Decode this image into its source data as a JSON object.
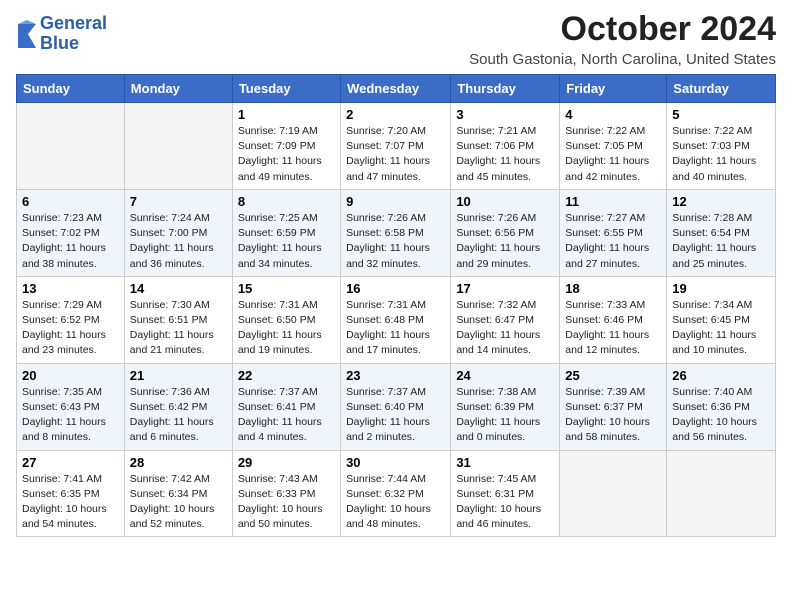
{
  "logo": {
    "line1": "General",
    "line2": "Blue"
  },
  "title": "October 2024",
  "subtitle": "South Gastonia, North Carolina, United States",
  "weekdays": [
    "Sunday",
    "Monday",
    "Tuesday",
    "Wednesday",
    "Thursday",
    "Friday",
    "Saturday"
  ],
  "weeks": [
    [
      {
        "day": "",
        "detail": ""
      },
      {
        "day": "",
        "detail": ""
      },
      {
        "day": "1",
        "detail": "Sunrise: 7:19 AM\nSunset: 7:09 PM\nDaylight: 11 hours and 49 minutes."
      },
      {
        "day": "2",
        "detail": "Sunrise: 7:20 AM\nSunset: 7:07 PM\nDaylight: 11 hours and 47 minutes."
      },
      {
        "day": "3",
        "detail": "Sunrise: 7:21 AM\nSunset: 7:06 PM\nDaylight: 11 hours and 45 minutes."
      },
      {
        "day": "4",
        "detail": "Sunrise: 7:22 AM\nSunset: 7:05 PM\nDaylight: 11 hours and 42 minutes."
      },
      {
        "day": "5",
        "detail": "Sunrise: 7:22 AM\nSunset: 7:03 PM\nDaylight: 11 hours and 40 minutes."
      }
    ],
    [
      {
        "day": "6",
        "detail": "Sunrise: 7:23 AM\nSunset: 7:02 PM\nDaylight: 11 hours and 38 minutes."
      },
      {
        "day": "7",
        "detail": "Sunrise: 7:24 AM\nSunset: 7:00 PM\nDaylight: 11 hours and 36 minutes."
      },
      {
        "day": "8",
        "detail": "Sunrise: 7:25 AM\nSunset: 6:59 PM\nDaylight: 11 hours and 34 minutes."
      },
      {
        "day": "9",
        "detail": "Sunrise: 7:26 AM\nSunset: 6:58 PM\nDaylight: 11 hours and 32 minutes."
      },
      {
        "day": "10",
        "detail": "Sunrise: 7:26 AM\nSunset: 6:56 PM\nDaylight: 11 hours and 29 minutes."
      },
      {
        "day": "11",
        "detail": "Sunrise: 7:27 AM\nSunset: 6:55 PM\nDaylight: 11 hours and 27 minutes."
      },
      {
        "day": "12",
        "detail": "Sunrise: 7:28 AM\nSunset: 6:54 PM\nDaylight: 11 hours and 25 minutes."
      }
    ],
    [
      {
        "day": "13",
        "detail": "Sunrise: 7:29 AM\nSunset: 6:52 PM\nDaylight: 11 hours and 23 minutes."
      },
      {
        "day": "14",
        "detail": "Sunrise: 7:30 AM\nSunset: 6:51 PM\nDaylight: 11 hours and 21 minutes."
      },
      {
        "day": "15",
        "detail": "Sunrise: 7:31 AM\nSunset: 6:50 PM\nDaylight: 11 hours and 19 minutes."
      },
      {
        "day": "16",
        "detail": "Sunrise: 7:31 AM\nSunset: 6:48 PM\nDaylight: 11 hours and 17 minutes."
      },
      {
        "day": "17",
        "detail": "Sunrise: 7:32 AM\nSunset: 6:47 PM\nDaylight: 11 hours and 14 minutes."
      },
      {
        "day": "18",
        "detail": "Sunrise: 7:33 AM\nSunset: 6:46 PM\nDaylight: 11 hours and 12 minutes."
      },
      {
        "day": "19",
        "detail": "Sunrise: 7:34 AM\nSunset: 6:45 PM\nDaylight: 11 hours and 10 minutes."
      }
    ],
    [
      {
        "day": "20",
        "detail": "Sunrise: 7:35 AM\nSunset: 6:43 PM\nDaylight: 11 hours and 8 minutes."
      },
      {
        "day": "21",
        "detail": "Sunrise: 7:36 AM\nSunset: 6:42 PM\nDaylight: 11 hours and 6 minutes."
      },
      {
        "day": "22",
        "detail": "Sunrise: 7:37 AM\nSunset: 6:41 PM\nDaylight: 11 hours and 4 minutes."
      },
      {
        "day": "23",
        "detail": "Sunrise: 7:37 AM\nSunset: 6:40 PM\nDaylight: 11 hours and 2 minutes."
      },
      {
        "day": "24",
        "detail": "Sunrise: 7:38 AM\nSunset: 6:39 PM\nDaylight: 11 hours and 0 minutes."
      },
      {
        "day": "25",
        "detail": "Sunrise: 7:39 AM\nSunset: 6:37 PM\nDaylight: 10 hours and 58 minutes."
      },
      {
        "day": "26",
        "detail": "Sunrise: 7:40 AM\nSunset: 6:36 PM\nDaylight: 10 hours and 56 minutes."
      }
    ],
    [
      {
        "day": "27",
        "detail": "Sunrise: 7:41 AM\nSunset: 6:35 PM\nDaylight: 10 hours and 54 minutes."
      },
      {
        "day": "28",
        "detail": "Sunrise: 7:42 AM\nSunset: 6:34 PM\nDaylight: 10 hours and 52 minutes."
      },
      {
        "day": "29",
        "detail": "Sunrise: 7:43 AM\nSunset: 6:33 PM\nDaylight: 10 hours and 50 minutes."
      },
      {
        "day": "30",
        "detail": "Sunrise: 7:44 AM\nSunset: 6:32 PM\nDaylight: 10 hours and 48 minutes."
      },
      {
        "day": "31",
        "detail": "Sunrise: 7:45 AM\nSunset: 6:31 PM\nDaylight: 10 hours and 46 minutes."
      },
      {
        "day": "",
        "detail": ""
      },
      {
        "day": "",
        "detail": ""
      }
    ]
  ]
}
